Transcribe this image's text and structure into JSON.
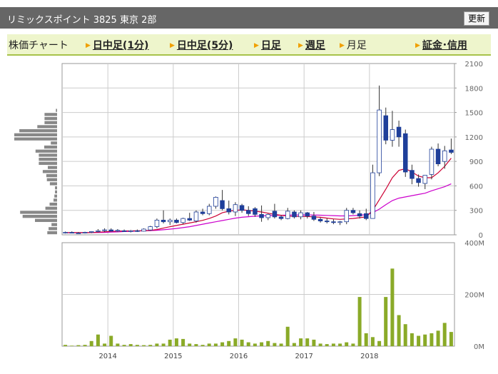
{
  "header": {
    "title": "リミックスポイント 3825 東京 2部",
    "refresh_label": "更新"
  },
  "tabs": [
    {
      "label": "株価チャート",
      "link": false,
      "arrow": false
    },
    {
      "label": "日中足(1分)",
      "link": true,
      "arrow": true
    },
    {
      "label": "日中足(5分)",
      "link": true,
      "arrow": true
    },
    {
      "label": "日足",
      "link": true,
      "arrow": true
    },
    {
      "label": "週足",
      "link": true,
      "arrow": true
    },
    {
      "label": "月足",
      "link": false,
      "arrow": true
    },
    {
      "label": "証金･信用",
      "link": true,
      "arrow": true
    }
  ],
  "colors": {
    "candle_down": "#1f3f9a",
    "candle_up_fill": "#ffffff",
    "candle_up_edge": "#1f3f9a",
    "wick": "#333333",
    "ma_short": "#cc0033",
    "ma_long": "#cc00cc",
    "volume_bar": "#8aaa28",
    "price_band_bar": "#888888",
    "grid": "#cccccc"
  },
  "chart_data": [
    {
      "type": "candlestick",
      "title": "",
      "y_ticks": [
        "0",
        "300",
        "600",
        "900",
        "1200",
        "1500",
        "1800",
        "2100"
      ],
      "ylim": [
        0,
        2100
      ],
      "x_ticks": [
        "2014",
        "2015",
        "2016",
        "2017",
        "2018"
      ],
      "x_ticks_at_index": [
        7,
        17,
        27,
        37,
        47
      ],
      "candles": [
        {
          "o": 25,
          "h": 40,
          "l": 15,
          "c": 30
        },
        {
          "o": 30,
          "h": 42,
          "l": 22,
          "c": 25
        },
        {
          "o": 20,
          "h": 35,
          "l": 12,
          "c": 22
        },
        {
          "o": 25,
          "h": 38,
          "l": 15,
          "c": 30
        },
        {
          "o": 30,
          "h": 45,
          "l": 20,
          "c": 40
        },
        {
          "o": 40,
          "h": 70,
          "l": 30,
          "c": 50
        },
        {
          "o": 50,
          "h": 80,
          "l": 35,
          "c": 60
        },
        {
          "o": 60,
          "h": 80,
          "l": 40,
          "c": 45
        },
        {
          "o": 45,
          "h": 70,
          "l": 35,
          "c": 55
        },
        {
          "o": 50,
          "h": 65,
          "l": 35,
          "c": 40
        },
        {
          "o": 40,
          "h": 60,
          "l": 30,
          "c": 50
        },
        {
          "o": 50,
          "h": 65,
          "l": 35,
          "c": 45
        },
        {
          "o": 45,
          "h": 80,
          "l": 40,
          "c": 70
        },
        {
          "o": 60,
          "h": 110,
          "l": 50,
          "c": 100
        },
        {
          "o": 100,
          "h": 200,
          "l": 80,
          "c": 180
        },
        {
          "o": 180,
          "h": 300,
          "l": 140,
          "c": 160
        },
        {
          "o": 160,
          "h": 200,
          "l": 120,
          "c": 180
        },
        {
          "o": 180,
          "h": 200,
          "l": 140,
          "c": 150
        },
        {
          "o": 150,
          "h": 210,
          "l": 130,
          "c": 200
        },
        {
          "o": 200,
          "h": 270,
          "l": 170,
          "c": 180
        },
        {
          "o": 170,
          "h": 300,
          "l": 150,
          "c": 280
        },
        {
          "o": 280,
          "h": 320,
          "l": 240,
          "c": 260
        },
        {
          "o": 260,
          "h": 380,
          "l": 240,
          "c": 350
        },
        {
          "o": 350,
          "h": 470,
          "l": 320,
          "c": 460
        },
        {
          "o": 420,
          "h": 550,
          "l": 300,
          "c": 320
        },
        {
          "o": 320,
          "h": 420,
          "l": 250,
          "c": 280
        },
        {
          "o": 280,
          "h": 400,
          "l": 230,
          "c": 370
        },
        {
          "o": 360,
          "h": 380,
          "l": 270,
          "c": 300
        },
        {
          "o": 300,
          "h": 350,
          "l": 230,
          "c": 260
        },
        {
          "o": 320,
          "h": 340,
          "l": 220,
          "c": 250
        },
        {
          "o": 250,
          "h": 360,
          "l": 160,
          "c": 210
        },
        {
          "o": 210,
          "h": 260,
          "l": 180,
          "c": 250
        },
        {
          "o": 290,
          "h": 380,
          "l": 200,
          "c": 220
        },
        {
          "o": 220,
          "h": 240,
          "l": 180,
          "c": 200
        },
        {
          "o": 200,
          "h": 330,
          "l": 190,
          "c": 290
        },
        {
          "o": 280,
          "h": 300,
          "l": 200,
          "c": 220
        },
        {
          "o": 220,
          "h": 300,
          "l": 190,
          "c": 270
        },
        {
          "o": 270,
          "h": 280,
          "l": 200,
          "c": 230
        },
        {
          "o": 230,
          "h": 280,
          "l": 170,
          "c": 190
        },
        {
          "o": 190,
          "h": 210,
          "l": 150,
          "c": 170
        },
        {
          "o": 170,
          "h": 200,
          "l": 140,
          "c": 160
        },
        {
          "o": 160,
          "h": 190,
          "l": 130,
          "c": 150
        },
        {
          "o": 150,
          "h": 170,
          "l": 120,
          "c": 160
        },
        {
          "o": 160,
          "h": 330,
          "l": 130,
          "c": 300
        },
        {
          "o": 300,
          "h": 330,
          "l": 250,
          "c": 270
        },
        {
          "o": 260,
          "h": 300,
          "l": 200,
          "c": 230
        },
        {
          "o": 260,
          "h": 320,
          "l": 180,
          "c": 200
        },
        {
          "o": 200,
          "h": 860,
          "l": 200,
          "c": 760
        },
        {
          "o": 760,
          "h": 1830,
          "l": 720,
          "c": 1530
        },
        {
          "o": 1460,
          "h": 1560,
          "l": 1110,
          "c": 1160
        },
        {
          "o": 1160,
          "h": 1520,
          "l": 1080,
          "c": 1290
        },
        {
          "o": 1320,
          "h": 1400,
          "l": 1080,
          "c": 1200
        },
        {
          "o": 1240,
          "h": 1290,
          "l": 710,
          "c": 770
        },
        {
          "o": 790,
          "h": 860,
          "l": 620,
          "c": 690
        },
        {
          "o": 690,
          "h": 740,
          "l": 590,
          "c": 640
        },
        {
          "o": 630,
          "h": 720,
          "l": 560,
          "c": 730
        },
        {
          "o": 740,
          "h": 1080,
          "l": 680,
          "c": 1050
        },
        {
          "o": 1050,
          "h": 1120,
          "l": 840,
          "c": 870
        },
        {
          "o": 900,
          "h": 1090,
          "l": 810,
          "c": 1030
        },
        {
          "o": 1040,
          "h": 1180,
          "l": 990,
          "c": 1010
        }
      ],
      "ma_short": [
        28,
        28,
        27,
        26,
        27,
        32,
        37,
        42,
        45,
        47,
        48,
        49,
        50,
        55,
        65,
        82,
        100,
        115,
        130,
        145,
        160,
        178,
        200,
        230,
        270,
        290,
        300,
        305,
        300,
        290,
        280,
        265,
        250,
        240,
        230,
        225,
        225,
        225,
        220,
        215,
        205,
        195,
        190,
        195,
        200,
        210,
        220,
        300,
        430,
        560,
        700,
        790,
        810,
        770,
        720,
        700,
        700,
        760,
        840,
        940
      ],
      "ma_long": [
        25,
        25,
        26,
        26,
        27,
        28,
        30,
        33,
        36,
        40,
        43,
        46,
        49,
        52,
        56,
        62,
        70,
        78,
        88,
        100,
        115,
        130,
        145,
        160,
        175,
        190,
        205,
        215,
        222,
        228,
        232,
        235,
        238,
        240,
        242,
        243,
        244,
        244,
        243,
        241,
        238,
        235,
        232,
        232,
        235,
        240,
        248,
        270,
        315,
        370,
        420,
        450,
        465,
        480,
        495,
        510,
        540,
        565,
        590,
        625
      ]
    },
    {
      "type": "bar",
      "title": "Volume",
      "y_ticks": [
        "0M",
        "200M",
        "400M"
      ],
      "ylim": [
        0,
        400
      ],
      "values": [
        5,
        2,
        4,
        5,
        20,
        45,
        10,
        40,
        10,
        5,
        8,
        5,
        4,
        5,
        10,
        10,
        25,
        30,
        28,
        10,
        8,
        5,
        10,
        10,
        15,
        20,
        30,
        25,
        15,
        10,
        15,
        20,
        12,
        10,
        75,
        12,
        30,
        30,
        25,
        10,
        8,
        10,
        10,
        15,
        10,
        190,
        50,
        35,
        20,
        190,
        300,
        120,
        85,
        50,
        40,
        45,
        50,
        60,
        90,
        55,
        45,
        20
      ]
    }
  ]
}
